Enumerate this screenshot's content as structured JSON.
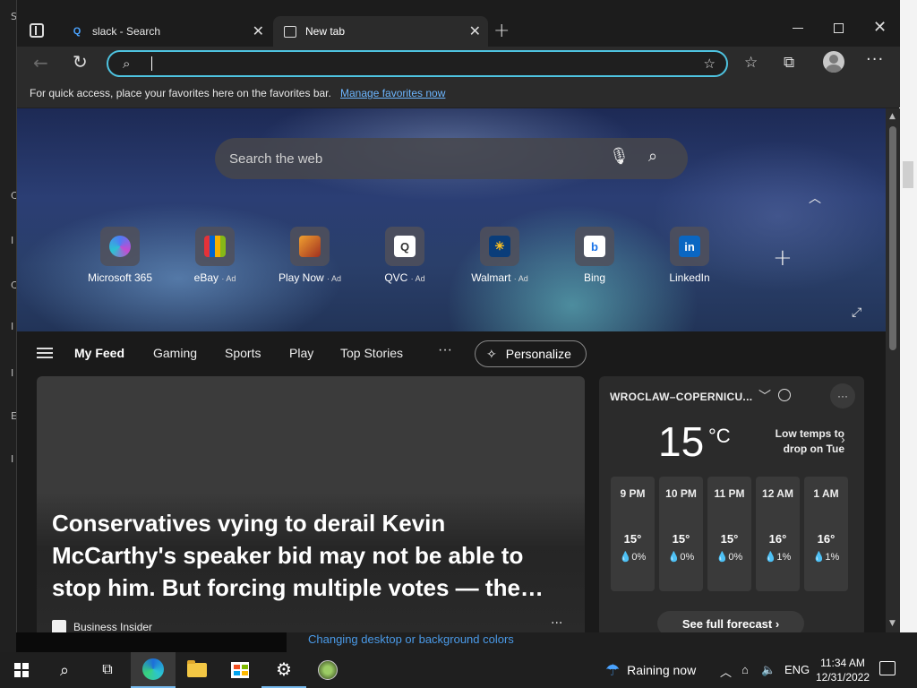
{
  "tabs": [
    {
      "label": "slack - Search",
      "favicon": "search-icon"
    },
    {
      "label": "New tab",
      "favicon": "page-icon"
    }
  ],
  "toolbar": {
    "address_value": "",
    "address_placeholder": ""
  },
  "favorites_bar": {
    "text": "For quick access, place your favorites here on the favorites bar.",
    "link": "Manage favorites now"
  },
  "hero": {
    "search_placeholder": "Search the web",
    "tiles": [
      {
        "label": "Microsoft 365",
        "ad": ""
      },
      {
        "label": "eBay",
        "ad": "· Ad"
      },
      {
        "label": "Play Now",
        "ad": "· Ad"
      },
      {
        "label": "QVC",
        "ad": "· Ad"
      },
      {
        "label": "Walmart",
        "ad": "· Ad"
      },
      {
        "label": "Bing",
        "ad": ""
      },
      {
        "label": "LinkedIn",
        "ad": ""
      }
    ]
  },
  "feed": {
    "tabs": [
      "My Feed",
      "Gaming",
      "Sports",
      "Play",
      "Top Stories"
    ],
    "more": "···",
    "personalize": "Personalize"
  },
  "card": {
    "headline": "Conservatives vying to derail Kevin McCarthy's speaker bid may not be able to stop him. But forcing multiple votes — the…",
    "source": "Business Insider",
    "more": "···"
  },
  "weather": {
    "location": "WROCLAW–COPERNICU...",
    "more": "···",
    "temp": "15",
    "unit": "°C",
    "note_line1": "Low temps to",
    "note_line2": "drop on Tue",
    "hours": [
      {
        "time": "9 PM",
        "temp": "15°",
        "precip": "0%"
      },
      {
        "time": "10 PM",
        "temp": "15°",
        "precip": "0%"
      },
      {
        "time": "11 PM",
        "temp": "15°",
        "precip": "0%"
      },
      {
        "time": "12 AM",
        "temp": "16°",
        "precip": "1%"
      },
      {
        "time": "1 AM",
        "temp": "16°",
        "precip": "1%"
      }
    ],
    "forecast_button": "See full forecast ›"
  },
  "background": {
    "link_text": "Changing desktop or background colors",
    "left_letters": [
      "S",
      "C",
      "I",
      "C",
      "I",
      "I",
      "E",
      "I"
    ]
  },
  "taskbar": {
    "weather_text": "Raining now",
    "lang": "ENG",
    "time": "11:34 AM",
    "date": "12/31/2022"
  },
  "colors": {
    "accent": "#4ec3e0",
    "link": "#6cb6ff"
  }
}
